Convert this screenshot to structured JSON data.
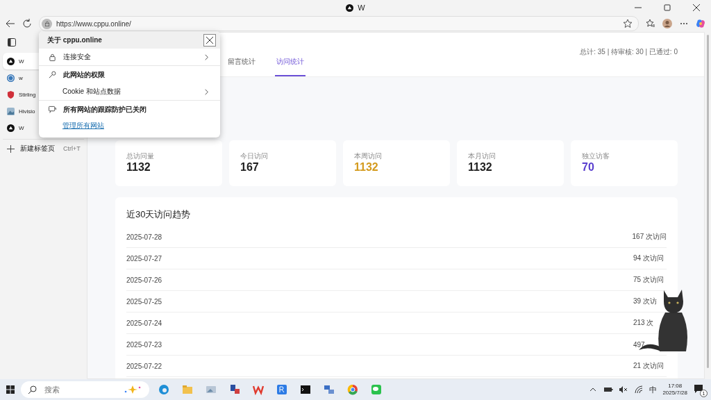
{
  "browser": {
    "tab_title": "W",
    "url": "https://www.cppu.online/"
  },
  "sidebar_tabs": [
    {
      "label": "W",
      "selected": true
    },
    {
      "label": "w",
      "selected": false
    },
    {
      "label": "Stirling",
      "selected": false
    },
    {
      "label": "Hivisio",
      "selected": false
    },
    {
      "label": "W",
      "selected": false
    }
  ],
  "new_tab": {
    "label": "新建标签页",
    "shortcut": "Ctrl+T"
  },
  "site_popup": {
    "title": "关于 cppu.online",
    "items": [
      {
        "kind": "row",
        "label": "连接安全",
        "chevron": true
      },
      {
        "kind": "heading",
        "label": "此网站的权限",
        "chevron": false
      },
      {
        "kind": "sub",
        "label": "Cookie 和站点数据",
        "chevron": true
      },
      {
        "kind": "heading",
        "label": "所有网站的跟踪防护已关闭",
        "chevron": false
      },
      {
        "kind": "link",
        "label": "管理所有网站",
        "chevron": false
      }
    ]
  },
  "page": {
    "summary": "总计: 35 | 待审核: 30 | 已通过: 0",
    "tabs": [
      {
        "label": "留言统计",
        "selected": false
      },
      {
        "label": "访问统计",
        "selected": true
      }
    ],
    "stats": [
      {
        "label": "总访问量",
        "value": "1132",
        "color": "#1f1f1f"
      },
      {
        "label": "今日访问",
        "value": "167",
        "color": "#1f1f1f"
      },
      {
        "label": "本周访问",
        "value": "1132",
        "color": "#d49a1c"
      },
      {
        "label": "本月访问",
        "value": "1132",
        "color": "#1f1f1f"
      },
      {
        "label": "独立访客",
        "value": "70",
        "color": "#5a3fcf"
      }
    ],
    "trend": {
      "title": "近30天访问趋势",
      "rows": [
        {
          "date": "2025-07-28",
          "reading": "167 次访问"
        },
        {
          "date": "2025-07-27",
          "reading": "94 次访问"
        },
        {
          "date": "2025-07-26",
          "reading": "75 次访问"
        },
        {
          "date": "2025-07-25",
          "reading": "39 次访"
        },
        {
          "date": "2025-07-24",
          "reading": "213 次"
        },
        {
          "date": "2025-07-23",
          "reading": "497"
        },
        {
          "date": "2025-07-22",
          "reading": "21 次访问"
        }
      ]
    }
  },
  "taskbar": {
    "search_placeholder": "搜索",
    "ime": "中",
    "time": "17:08",
    "date": "2025/7/28",
    "notifications": "1"
  }
}
